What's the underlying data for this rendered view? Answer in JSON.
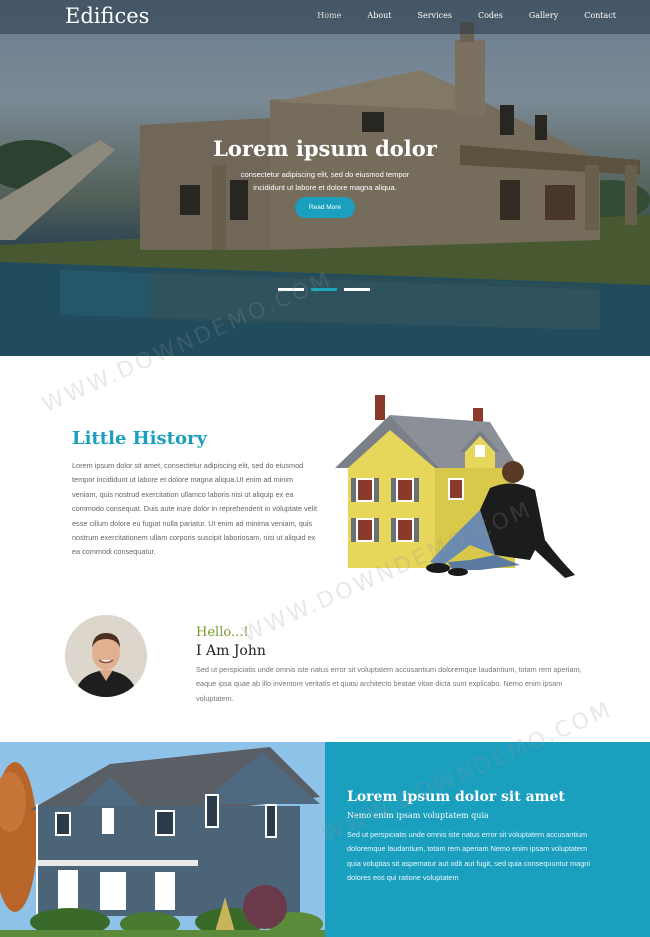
{
  "header": {
    "brand": "Edifices",
    "nav": [
      {
        "label": "Home",
        "active": true
      },
      {
        "label": "About"
      },
      {
        "label": "Services"
      },
      {
        "label": "Codes"
      },
      {
        "label": "Gallery"
      },
      {
        "label": "Contact"
      }
    ]
  },
  "hero": {
    "title": "Lorem ipsum dolor",
    "text": "consectetur adipiscing elit, sed do eiusmod tempor incididunt ut labore et dolore magna aliqua.",
    "button": "Read More",
    "slides": 3,
    "active_slide": 2
  },
  "history": {
    "title": "Little History",
    "text": "Lorem ipsum dolor sit amet, consectetur adipiscing elit, sed do eiusmod tempor incididunt ut labore et dolore magna aliqua.Ut enim ad minim veniam, quis nostrud exercitation ullamco laboris nisi ut aliquip ex ea commodo consequat. Duis aute irure dolor in reprehenderit in voluptate velit esse cillum dolore eu fugiat nulla pariatur. Ut enim ad minima veniam, quis nostrum exercitationem ullam corporis suscipit laboriosam, nisi ut aliquid ex ea commodi consequatur."
  },
  "profile": {
    "greeting": "Hello...!",
    "name": "I Am John",
    "text": "Sed ut perspiciatis unde omnis iste natus error sit voluptatem accusantium doloremque laudantium, totam rem aperiam, eaque ipsa quae ab illo inventore veritatis et quasi architecto beatae vitae dicta sunt explicabo. Nemo enim ipsam voluptatem."
  },
  "feature": {
    "title": "Lorem ipsum dolor sit amet",
    "subtitle": "Nemo enim ipsam voluptatem quia",
    "text": "Sed ut perspiciatis unde omnis iste natus error sit voluptatem accusantium doloremque laudantium, totam rem aperiam Nemo enim ipsam voluptatem quia voluptas sit aspernatur aut odit aut fugit, sed quia consequuntur magni dolores eos qui ratione voluptatem"
  },
  "watermark": "WWW.DOWNDEMO.COM",
  "colors": {
    "accent": "#1a9fbf",
    "greeting": "#7a9a2e",
    "slide_active": "#1ba6b8"
  }
}
